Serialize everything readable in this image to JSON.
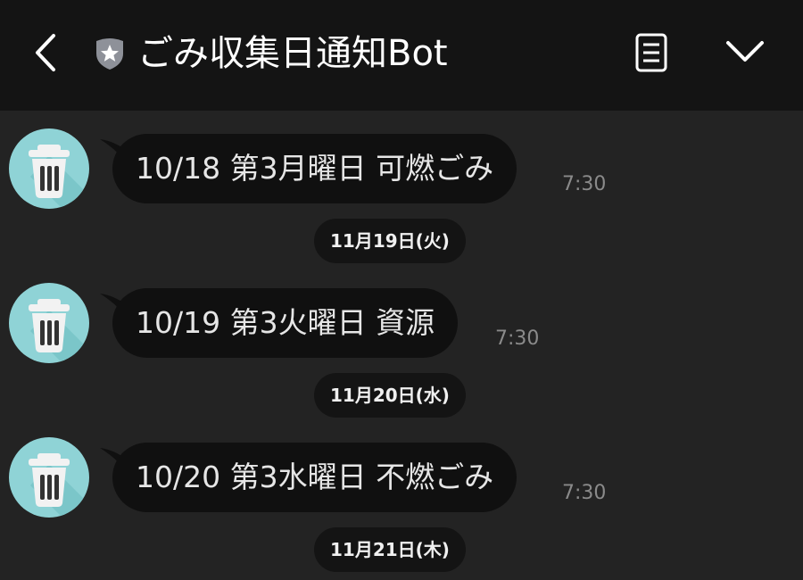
{
  "header": {
    "title": "ごみ収集日通知Bot",
    "icons": {
      "back": "chevron-left-icon",
      "badge": "shield-star-icon",
      "notes": "notes-icon",
      "menu": "chevron-down-icon"
    }
  },
  "messages": [
    {
      "text": "10/18 第3月曜日 可燃ごみ",
      "time": "7:30"
    },
    {
      "text": "10/19 第3火曜日 資源",
      "time": "7:30"
    },
    {
      "text": "10/20 第3水曜日 不燃ごみ",
      "time": "7:30"
    }
  ],
  "date_separators": [
    "11月19日(火)",
    "11月20日(水)",
    "11月21日(木)"
  ],
  "colors": {
    "header_bg": "#141414",
    "chat_bg": "#232323",
    "bubble_bg": "#101010",
    "avatar_bg": "#8fd3d6"
  }
}
